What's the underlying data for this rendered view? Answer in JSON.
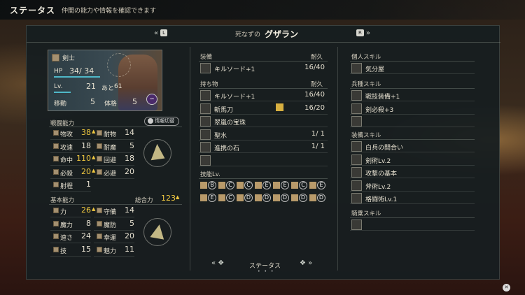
{
  "header": {
    "title": "ステータス",
    "description": "仲間の能力や情報を確認できます"
  },
  "nav": {
    "prev_key": "L",
    "next_key": "R",
    "prev_arrows": "«",
    "next_arrows": "»",
    "epithet": "死なずの",
    "name": "グザラン"
  },
  "unit": {
    "class": "剣士",
    "hp_label": "HP",
    "hp": "34/ 34",
    "lv_label": "Lv.",
    "lv": "21",
    "exp_label": "あと",
    "exp": "61",
    "move_label": "移動",
    "move": "5",
    "build_label": "体格",
    "build": "5"
  },
  "combat": {
    "title": "戦闘能力",
    "toggle": "情報切替",
    "stats": [
      {
        "l": "物攻",
        "v": "38",
        "up": true
      },
      {
        "l": "耐物",
        "v": "14",
        "up": false
      },
      {
        "l": "攻速",
        "v": "18",
        "up": false
      },
      {
        "l": "耐魔",
        "v": "5",
        "up": false
      },
      {
        "l": "命中",
        "v": "110",
        "up": true
      },
      {
        "l": "回避",
        "v": "18",
        "up": false
      },
      {
        "l": "必殺",
        "v": "20",
        "up": true
      },
      {
        "l": "必避",
        "v": "20",
        "up": false
      },
      {
        "l": "射程",
        "v": "1",
        "up": false
      }
    ]
  },
  "base": {
    "title": "基本能力",
    "total_label": "総合力",
    "total": "123",
    "stats": [
      {
        "l": "力",
        "v": "26",
        "up": true
      },
      {
        "l": "守備",
        "v": "14",
        "up": false
      },
      {
        "l": "魔力",
        "v": "8",
        "up": false
      },
      {
        "l": "魔防",
        "v": "5",
        "up": false
      },
      {
        "l": "速さ",
        "v": "24",
        "up": false
      },
      {
        "l": "幸運",
        "v": "20",
        "up": false
      },
      {
        "l": "技",
        "v": "15",
        "up": false
      },
      {
        "l": "魅力",
        "v": "11",
        "up": false
      }
    ]
  },
  "equip": {
    "title": "装備",
    "dur_label": "耐久",
    "item": {
      "name": "キルソード+1",
      "dur": "16/40"
    }
  },
  "inventory": {
    "title": "持ち物",
    "dur_label": "耐久",
    "items": [
      {
        "name": "キルソード+1",
        "dur": "16/40"
      },
      {
        "name": "斬馬刀",
        "dur": "16/20"
      },
      {
        "name": "翠嵐の宝珠",
        "dur": ""
      },
      {
        "name": "聖水",
        "dur": "1/  1"
      },
      {
        "name": "進携の石",
        "dur": "1/  1"
      },
      {
        "name": "",
        "dur": ""
      }
    ]
  },
  "weapon_levels": {
    "title": "技能Lv.",
    "row1": [
      "B",
      "C",
      "C",
      "E",
      "E",
      "C",
      "E"
    ],
    "row2": [
      "E",
      "C",
      "D",
      "D",
      "D",
      "D",
      "D"
    ]
  },
  "personal": {
    "title": "個人スキル",
    "skills": [
      "気分屋"
    ]
  },
  "class_skills": {
    "title": "兵種スキル",
    "skills": [
      "戦技装備+1",
      "剣必殺+3",
      ""
    ]
  },
  "equip_skills": {
    "title": "装備スキル",
    "skills": [
      "白兵の間合い",
      "剣術Lv.2",
      "攻撃の基本",
      "斧術Lv.2",
      "格闘術Lv.1"
    ]
  },
  "mount_skills": {
    "title": "騎乗スキル",
    "skills": [
      ""
    ]
  },
  "footer": {
    "page_label": "ステータス"
  },
  "colors": {
    "accent_yellow": "#f0c840",
    "panel": "#161e20"
  }
}
